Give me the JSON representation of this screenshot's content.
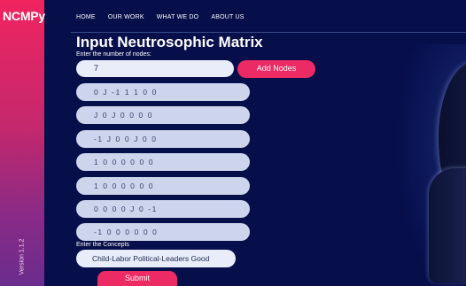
{
  "brand": {
    "name": "NCMPy",
    "version": "Version 1.1.2"
  },
  "nav": {
    "items": [
      "HOME",
      "OUR WORK",
      "WHAT WE DO",
      "ABOUT US"
    ]
  },
  "main": {
    "title": "Input Neutrosophic Matrix",
    "nodes_label": "Enter the number of nodes:",
    "nodes_value": "7",
    "add_button": "Add Nodes",
    "matrix_rows": [
      "0 J -1 1 1 0 0",
      "J 0 J 0 0 0 0",
      "-1 J 0 0 J 0 0",
      "1 0 0 0 0 0 0",
      "1 0 0 0 0 0 0",
      "0 0 0 0 J 0 -1",
      "-1 0 0 0 0 0 0"
    ],
    "concepts_label": "Enter the Concepts",
    "concepts_value": "Child-Labor Political-Leaders Good",
    "submit_button": "Submit"
  },
  "colors": {
    "background": "#070f4a",
    "accent": "#ec2a64",
    "sidebar_top": "#f0245f",
    "sidebar_bottom": "#6a2d8e",
    "row_fill": "#cdd5ec"
  }
}
